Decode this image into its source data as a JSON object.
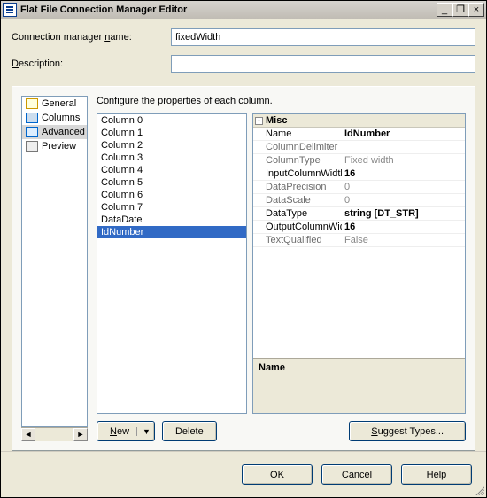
{
  "window": {
    "title": "Flat File Connection Manager Editor",
    "min": "_",
    "restore": "❐",
    "close": "×"
  },
  "fields": {
    "name_label_pre": "Connection manager ",
    "name_label_mn": "n",
    "name_label_post": "ame:",
    "name_value": "fixedWidth",
    "desc_label_pre": "",
    "desc_label_mn": "D",
    "desc_label_post": "escription:",
    "desc_value": ""
  },
  "nav": {
    "items": [
      {
        "label": "General"
      },
      {
        "label": "Columns"
      },
      {
        "label": "Advanced",
        "selected": true
      },
      {
        "label": "Preview"
      }
    ],
    "scroll_left": "◄",
    "scroll_right": "►"
  },
  "content": {
    "hint": "Configure the properties of each column.",
    "columns": {
      "items": [
        "Column 0",
        "Column 1",
        "Column 2",
        "Column 3",
        "Column 4",
        "Column 5",
        "Column 6",
        "Column 7",
        "DataDate",
        "IdNumber"
      ],
      "selected_index": 9
    },
    "props": {
      "category": "Misc",
      "rows": [
        {
          "k": "Name",
          "v": "IdNumber",
          "strong": true
        },
        {
          "k": "ColumnDelimiter",
          "v": ""
        },
        {
          "k": "ColumnType",
          "v": "Fixed width"
        },
        {
          "k": "InputColumnWidth",
          "v": "16",
          "strong": true
        },
        {
          "k": "DataPrecision",
          "v": "0"
        },
        {
          "k": "DataScale",
          "v": "0"
        },
        {
          "k": "DataType",
          "v": "string [DT_STR]",
          "strong": true
        },
        {
          "k": "OutputColumnWidth",
          "v": "16",
          "strong": true
        },
        {
          "k": "TextQualified",
          "v": "False"
        }
      ],
      "desc_title": "Name",
      "desc_text": ""
    },
    "new_btn_mn": "N",
    "new_btn_post": "ew",
    "new_btn_arrow": "▼",
    "delete_btn": "Delete",
    "suggest_pre": "",
    "suggest_mn": "S",
    "suggest_post": "uggest Types..."
  },
  "footer": {
    "ok": "OK",
    "cancel": "Cancel",
    "help_mn": "H",
    "help_post": "elp"
  }
}
